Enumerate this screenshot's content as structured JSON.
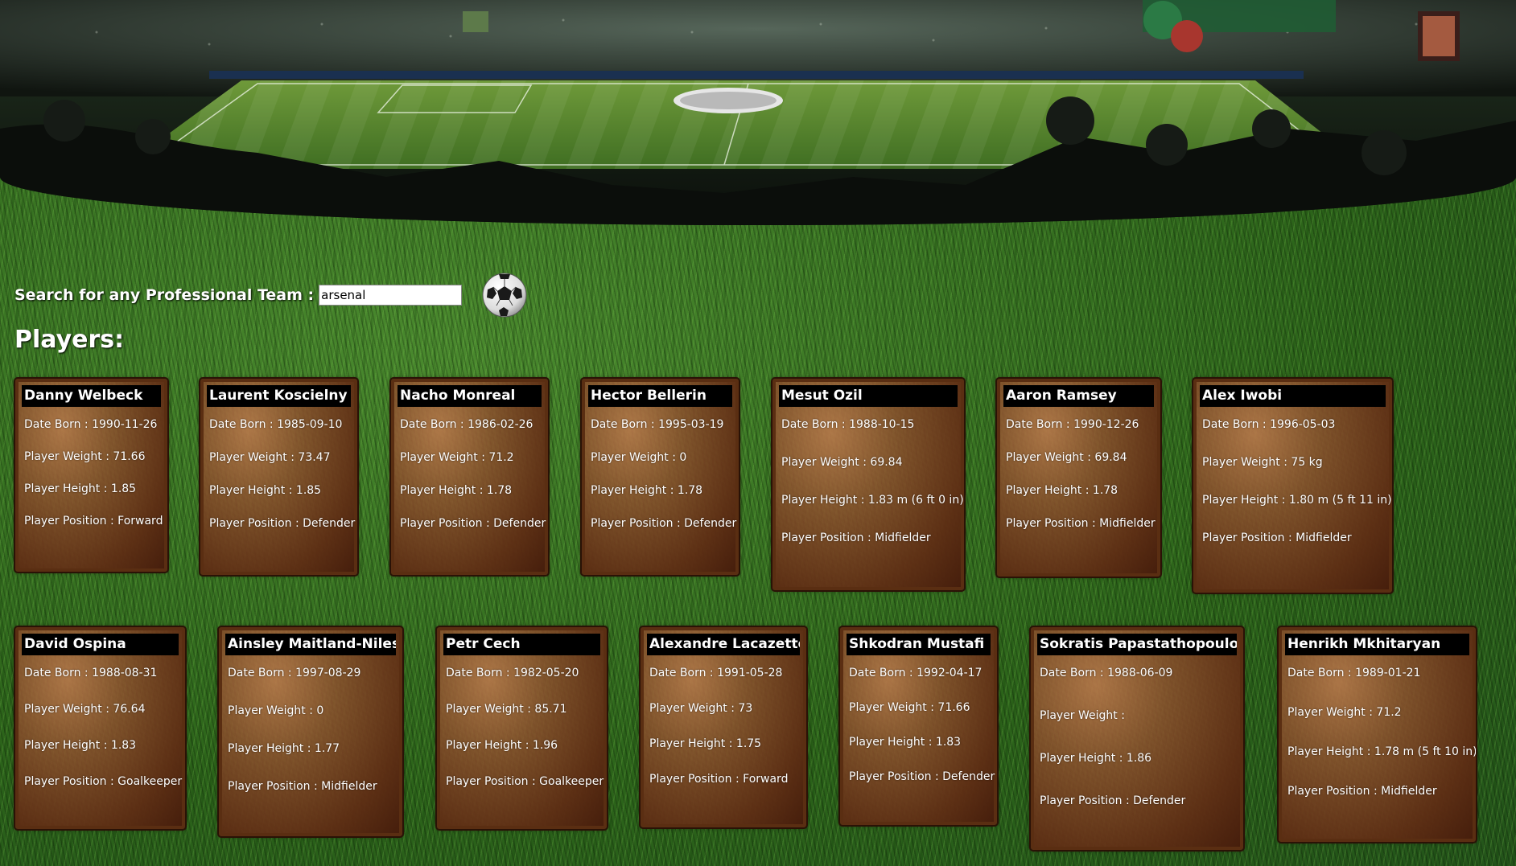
{
  "search": {
    "label": "Search for any Professional Team :",
    "value": "arsenal"
  },
  "players_heading": "Players:",
  "field_labels": {
    "born": "Date Born",
    "weight": "Player Weight",
    "height": "Player Height",
    "position": "Player Position"
  },
  "players": [
    {
      "name": "Danny Welbeck",
      "born": "1990-11-26",
      "weight": "71.66",
      "height": "1.85",
      "position": "Forward"
    },
    {
      "name": "Laurent Koscielny",
      "born": "1985-09-10",
      "weight": "73.47",
      "height": "1.85",
      "position": "Defender"
    },
    {
      "name": "Nacho Monreal",
      "born": "1986-02-26",
      "weight": "71.2",
      "height": "1.78",
      "position": "Defender"
    },
    {
      "name": "Hector Bellerin",
      "born": "1995-03-19",
      "weight": "0",
      "height": "1.78",
      "position": "Defender"
    },
    {
      "name": "Mesut Ozil",
      "born": "1988-10-15",
      "weight": "69.84",
      "height": "1.83 m (6 ft 0 in)",
      "position": "Midfielder"
    },
    {
      "name": "Aaron Ramsey",
      "born": "1990-12-26",
      "weight": "69.84",
      "height": "1.78",
      "position": "Midfielder"
    },
    {
      "name": "Alex Iwobi",
      "born": "1996-05-03",
      "weight": "75 kg",
      "height": "1.80 m (5 ft 11 in)",
      "position": "Midfielder"
    },
    {
      "name": "David Ospina",
      "born": "1988-08-31",
      "weight": "76.64",
      "height": "1.83",
      "position": "Goalkeeper"
    },
    {
      "name": "Ainsley Maitland-Niles",
      "born": "1997-08-29",
      "weight": "0",
      "height": "1.77",
      "position": "Midfielder"
    },
    {
      "name": "Petr Cech",
      "born": "1982-05-20",
      "weight": "85.71",
      "height": "1.96",
      "position": "Goalkeeper"
    },
    {
      "name": "Alexandre Lacazette",
      "born": "1991-05-28",
      "weight": "73",
      "height": "1.75",
      "position": "Forward"
    },
    {
      "name": "Shkodran Mustafi",
      "born": "1992-04-17",
      "weight": "71.66",
      "height": "1.83",
      "position": "Defender"
    },
    {
      "name": "Sokratis Papastathopoulos",
      "born": "1988-06-09",
      "weight": "",
      "height": "1.86",
      "position": "Defender"
    },
    {
      "name": "Henrikh Mkhitaryan",
      "born": "1989-01-21",
      "weight": "71.2",
      "height": "1.78 m (5 ft 10 in)",
      "position": "Midfielder"
    }
  ]
}
